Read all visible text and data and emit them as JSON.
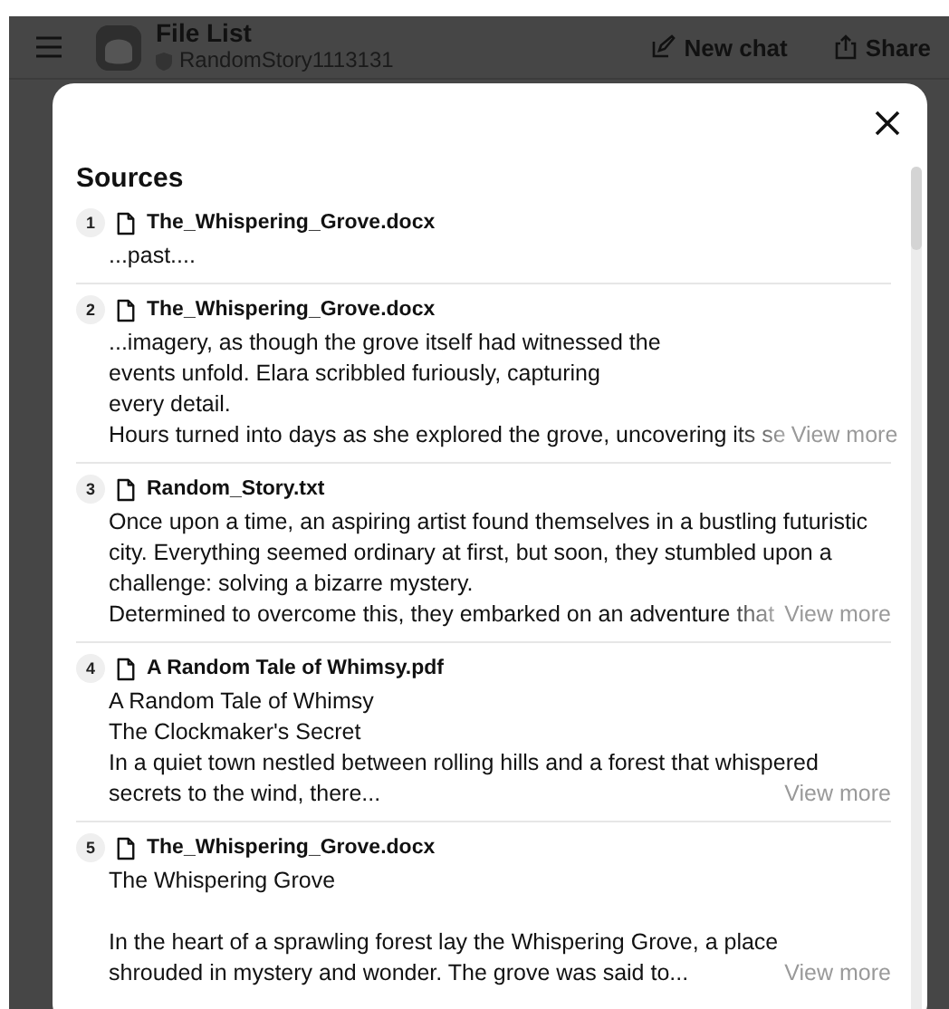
{
  "header": {
    "title": "File List",
    "subtitle": "RandomStory1113131",
    "actions": [
      "New chat",
      "Share"
    ]
  },
  "dialog": {
    "title": "Sources",
    "sources": [
      {
        "number": "1",
        "file": "The_Whispering_Grove.docx",
        "paragraphs": [
          [
            "...past...."
          ]
        ]
      },
      {
        "number": "2",
        "file": "The_Whispering_Grove.docx",
        "paragraphs": [
          [
            "...imagery, as though the grove itself had witnessed the",
            "events unfold. Elara scribbled furiously, capturing",
            "every detail.",
            "Hours turned into days as she explored the grove, uncovering its se"
          ]
        ],
        "view_more": "View more"
      },
      {
        "number": "3",
        "file": "Random_Story.txt",
        "paragraphs": [
          [
            "Once upon a time, an aspiring artist found themselves in a bustling futuristic",
            "city. Everything seemed ordinary at first, but soon, they stumbled upon a",
            "challenge: solving a bizarre mystery.",
            "Determined to overcome this, they embarked on an adventure that"
          ]
        ],
        "view_more": "View more"
      },
      {
        "number": "4",
        "file": "A Random Tale of Whimsy.pdf",
        "paragraphs": [
          [
            "A Random Tale of Whimsy",
            "The Clockmaker's Secret",
            "In a quiet town nestled between rolling hills and a forest that whispered",
            "secrets to the wind, there..."
          ]
        ],
        "view_more": "View more"
      },
      {
        "number": "5",
        "file": "The_Whispering_Grove.docx",
        "paragraphs": [
          [
            "The Whispering Grove"
          ],
          [
            "In the heart of a sprawling forest lay the Whispering Grove, a place",
            "shrouded in mystery and wonder. The grove was said to..."
          ]
        ],
        "view_more": "View more"
      }
    ]
  }
}
